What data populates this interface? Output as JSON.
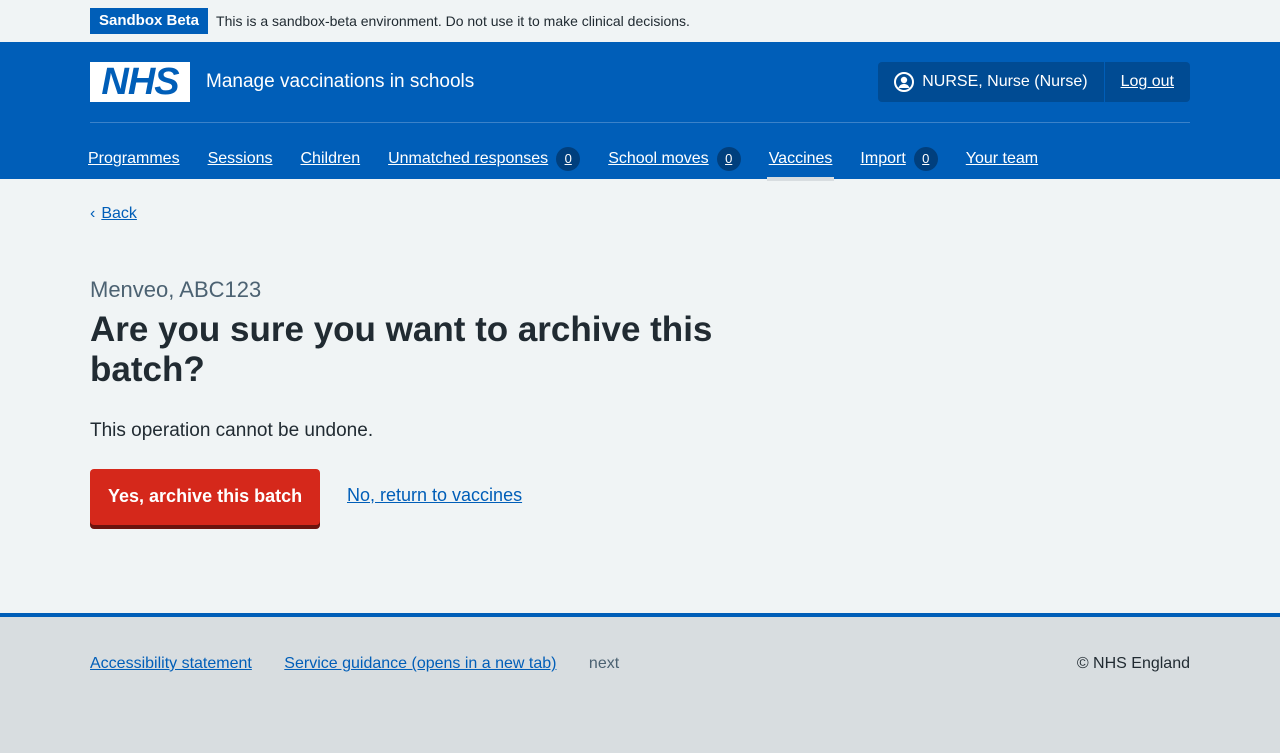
{
  "banner": {
    "tag": "Sandbox Beta",
    "text": "This is a sandbox-beta environment. Do not use it to make clinical decisions."
  },
  "header": {
    "logo": "NHS",
    "service": "Manage vaccinations in schools",
    "user": "NURSE, Nurse (Nurse)",
    "logout": "Log out"
  },
  "nav": [
    {
      "label": "Programmes"
    },
    {
      "label": "Sessions"
    },
    {
      "label": "Children"
    },
    {
      "label": "Unmatched responses",
      "count": "0"
    },
    {
      "label": "School moves",
      "count": "0"
    },
    {
      "label": "Vaccines",
      "current": true
    },
    {
      "label": "Import",
      "count": "0"
    },
    {
      "label": "Your team"
    }
  ],
  "main": {
    "back": "Back",
    "caption": "Menveo, ABC123",
    "title": "Are you sure you want to archive this batch?",
    "body": "This operation cannot be undone.",
    "confirm": "Yes, archive this batch",
    "cancel": "No, return to vaccines"
  },
  "footer": {
    "links": [
      "Accessibility statement",
      "Service guidance (opens in a new tab)"
    ],
    "version": "next",
    "copyright": "© NHS England"
  }
}
